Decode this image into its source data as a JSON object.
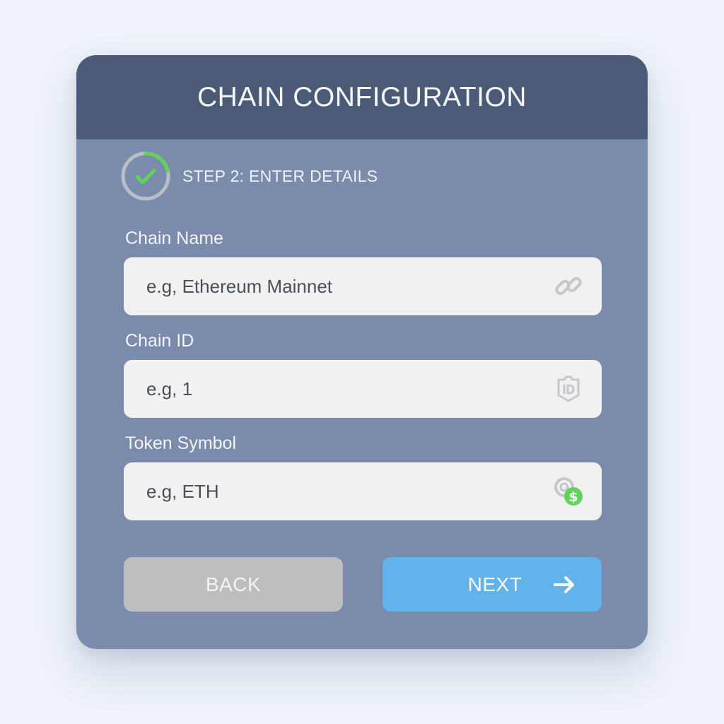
{
  "header": {
    "title": "CHAIN CONFIGURATION"
  },
  "step": {
    "label": "STEP 2: ENTER DETAILS",
    "icon": "check-progress-icon",
    "progress_fraction": 0.3
  },
  "fields": [
    {
      "label": "Chain Name",
      "placeholder": "e.g, Ethereum Mainnet",
      "value": "",
      "icon": "link-icon"
    },
    {
      "label": "Chain ID",
      "placeholder": "e.g, 1",
      "value": "",
      "icon": "id-badge-icon"
    },
    {
      "label": "Token Symbol",
      "placeholder": "e.g, ETH",
      "value": "",
      "icon": "coin-dollar-icon"
    }
  ],
  "buttons": {
    "back_label": "BACK",
    "next_label": "NEXT",
    "next_icon": "arrow-right-icon"
  },
  "colors": {
    "header": "#4b5a76",
    "card": "#7b8bab",
    "accent_green": "#5fd35a",
    "next_button": "#62b2ec",
    "back_button": "#bdbec0"
  }
}
